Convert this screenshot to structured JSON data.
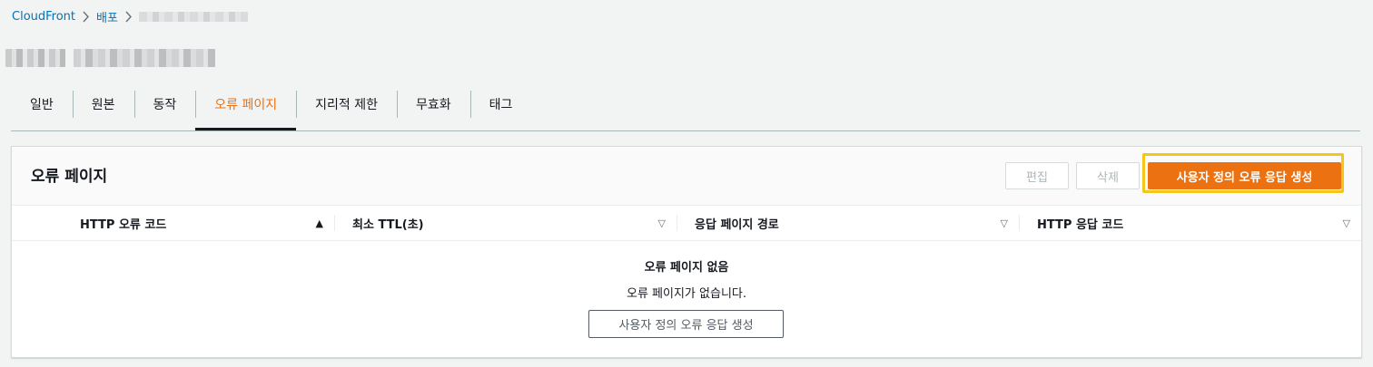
{
  "breadcrumb": {
    "items": [
      "CloudFront",
      "배포"
    ]
  },
  "tabs": [
    "일반",
    "원본",
    "동작",
    "오류 페이지",
    "지리적 제한",
    "무효화",
    "태그"
  ],
  "active_tab_index": 3,
  "panel": {
    "title": "오류 페이지",
    "edit_label": "편집",
    "delete_label": "삭제",
    "create_label": "사용자 정의 오류 응답 생성"
  },
  "table": {
    "columns": [
      "HTTP 오류 코드",
      "최소 TTL(초)",
      "응답 페이지 경로",
      "HTTP 응답 코드"
    ],
    "sort_icons": [
      "▲",
      "▽",
      "▽",
      "▽"
    ],
    "rows": []
  },
  "empty_state": {
    "title": "오류 페이지 없음",
    "description": "오류 페이지가 없습니다.",
    "button_label": "사용자 정의 오류 응답 생성"
  },
  "colors": {
    "accent": "#ec7211",
    "link": "#0073bb",
    "highlight": "#f5c518"
  }
}
